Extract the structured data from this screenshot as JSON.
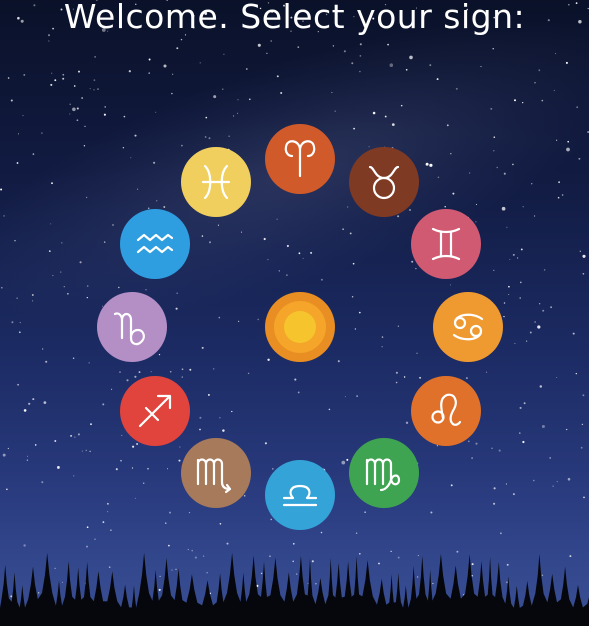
{
  "header": {
    "title": "Welcome. Select your sign:"
  },
  "signs": [
    {
      "name": "aries",
      "color": "#d05a2a"
    },
    {
      "name": "taurus",
      "color": "#7f3a24"
    },
    {
      "name": "gemini",
      "color": "#d05a72"
    },
    {
      "name": "cancer",
      "color": "#ef9a30"
    },
    {
      "name": "leo",
      "color": "#e0712a"
    },
    {
      "name": "virgo",
      "color": "#3fa451"
    },
    {
      "name": "libra",
      "color": "#34a3d8"
    },
    {
      "name": "scorpio",
      "color": "#a67a5a"
    },
    {
      "name": "sagittarius",
      "color": "#e0443c"
    },
    {
      "name": "capricorn",
      "color": "#b48fc6"
    },
    {
      "name": "aquarius",
      "color": "#2e9ee0"
    },
    {
      "name": "pisces",
      "color": "#f0cf5e"
    }
  ],
  "center": {
    "name": "sun-icon",
    "color": "#f4a52a"
  }
}
